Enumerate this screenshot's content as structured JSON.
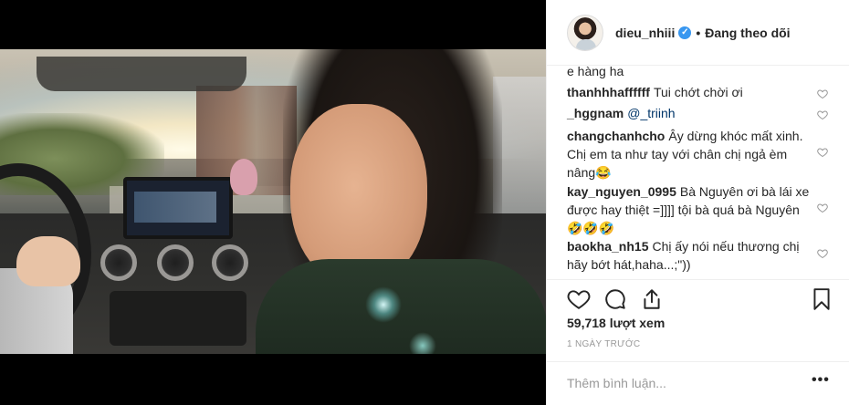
{
  "header": {
    "username": "dieu_nhiii",
    "dot": "•",
    "follow_status": "Đang theo dõi"
  },
  "comments": [
    {
      "user": "",
      "text": "e hàng ha"
    },
    {
      "user": "thanhhhaffffff",
      "text": "Tui chớt chời ơi"
    },
    {
      "user": "_hggnam",
      "mention": "@_triinh",
      "text": ""
    },
    {
      "user": "changchanhcho",
      "text": "Ây dừng khóc mất xinh. Chị em ta như tay với chân chị ngả èm nâng😂"
    },
    {
      "user": "kay_nguyen_0995",
      "text": "Bà Nguyên ơi bà lái xe được hay thiệt =]]]] tội bà quá bà Nguyên 🤣🤣🤣"
    },
    {
      "user": "baokha_nh15",
      "text": "Chị ấy nói nếu thương chị hãy bớt hát,haha...;\"))"
    }
  ],
  "views": "59,718 lượt xem",
  "timestamp": "1 NGÀY TRƯỚC",
  "add_comment": {
    "placeholder": "Thêm bình luận...",
    "more_label": "•••"
  },
  "icons": {
    "verified": "verified-badge-icon",
    "like": "heart-outline-icon",
    "comment": "speech-bubble-icon",
    "share": "share-upload-icon",
    "save": "bookmark-icon",
    "comment_like": "small-heart-icon"
  },
  "colors": {
    "verified_blue": "#3897f0",
    "text": "#262626",
    "muted": "#999999",
    "border": "#efefef"
  }
}
